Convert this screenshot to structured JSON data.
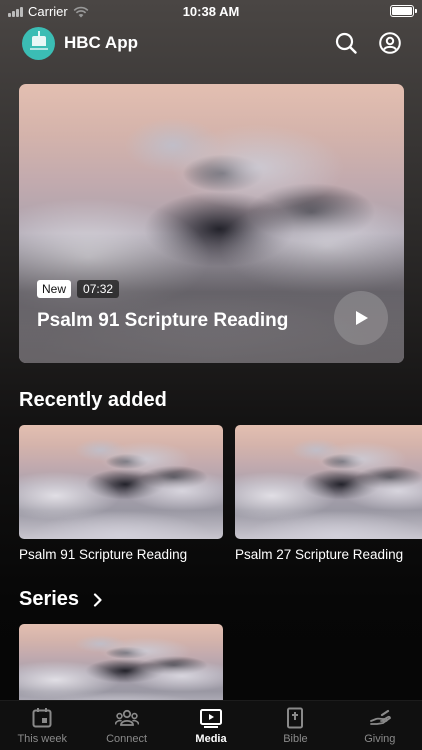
{
  "status_bar": {
    "carrier": "Carrier",
    "time": "10:38 AM"
  },
  "header": {
    "app_title": "HBC App",
    "icons": [
      "search-icon",
      "profile-icon"
    ]
  },
  "hero": {
    "badge_new": "New",
    "duration": "07:32",
    "title": "Psalm 91 Scripture Reading"
  },
  "sections": {
    "recent": {
      "title": "Recently added",
      "items": [
        {
          "title": "Psalm 91 Scripture Reading"
        },
        {
          "title": "Psalm 27 Scripture Reading"
        }
      ]
    },
    "series": {
      "title": "Series"
    }
  },
  "tabs": [
    {
      "label": "This week",
      "icon": "calendar-icon",
      "active": false
    },
    {
      "label": "Connect",
      "icon": "people-icon",
      "active": false
    },
    {
      "label": "Media",
      "icon": "play-screen-icon",
      "active": true
    },
    {
      "label": "Bible",
      "icon": "bible-icon",
      "active": false
    },
    {
      "label": "Giving",
      "icon": "giving-hand-icon",
      "active": false
    }
  ],
  "colors": {
    "logo_teal": "#3bbdb4",
    "inactive_tab": "#8a8a8a",
    "background": "#050505"
  }
}
